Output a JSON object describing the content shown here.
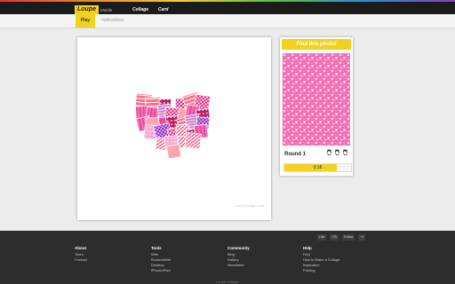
{
  "header": {
    "logo": "Loupe",
    "logo_sub": "Mobile",
    "nav": [
      "Collage",
      "Card"
    ]
  },
  "tabs": [
    {
      "label": "Play",
      "active": true
    },
    {
      "label": "Instructions",
      "active": false
    }
  ],
  "photo": {
    "watermark": "LoupeCollage.com"
  },
  "game": {
    "title": "Find this photo!",
    "round_label": "Round 1",
    "lives": 3,
    "timer_text": "0:16",
    "timer_fraction": 0.78
  },
  "footer": {
    "social": [
      "Like",
      "17k",
      "Follow",
      "+1"
    ],
    "columns": [
      {
        "title": "About",
        "links": [
          "Team",
          "Contact"
        ]
      },
      {
        "title": "Tools",
        "links": [
          "Web",
          "Bookmarklet",
          "Desktop",
          "iPhone/iPad"
        ]
      },
      {
        "title": "Community",
        "links": [
          "Blog",
          "Gallery",
          "Newsletter"
        ]
      },
      {
        "title": "Help",
        "links": [
          "FAQ",
          "How to Make a Collage",
          "Inspiration",
          "Printing"
        ]
      }
    ],
    "copyright": "Loupe Collage"
  },
  "colors": {
    "accent": "#f3d21d",
    "topbar": "#1b1b1b",
    "footer": "#2d2d2d",
    "target_pattern": "#f472b6"
  }
}
